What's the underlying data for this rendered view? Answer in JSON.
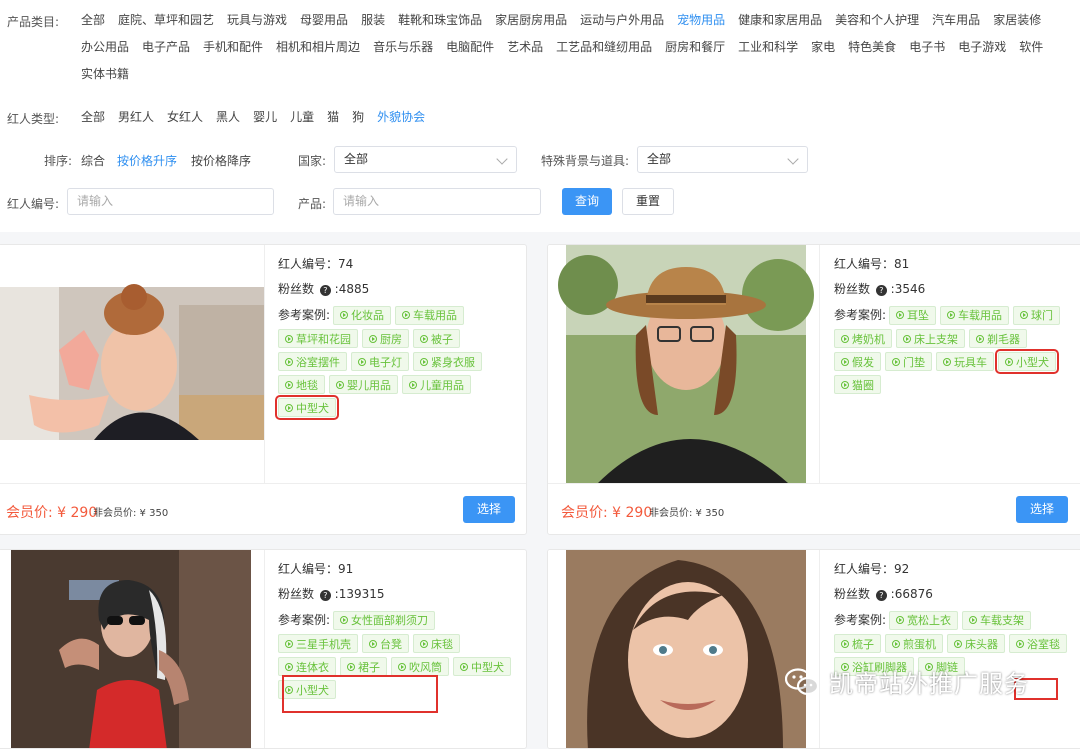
{
  "filters": {
    "category_label": "产品类目:",
    "categories": [
      "全部",
      "庭院、草坪和园艺",
      "玩具与游戏",
      "母婴用品",
      "服装",
      "鞋靴和珠宝饰品",
      "家居厨房用品",
      "运动与户外用品",
      "宠物用品",
      "健康和家居用品",
      "美容和个人护理",
      "汽车用品",
      "家居装修",
      "办公用品",
      "电子产品",
      "手机和配件",
      "相机和相片周边",
      "音乐与乐器",
      "电脑配件",
      "艺术品",
      "工艺品和缝纫用品",
      "厨房和餐厅",
      "工业和科学",
      "家电",
      "特色美食",
      "电子书",
      "电子游戏",
      "软件",
      "实体书籍"
    ],
    "active_category": "宠物用品",
    "influencer_label": "红人类型:",
    "influencer_types": [
      "全部",
      "男红人",
      "女红人",
      "黑人",
      "婴儿",
      "儿童",
      "猫",
      "狗",
      "外貌协会"
    ],
    "active_influencer": "外貌协会",
    "sort_label": "排序:",
    "sort_options": [
      "综合",
      "按价格升序",
      "按价格降序"
    ],
    "active_sort": "按价格升序",
    "country_label": "国家:",
    "country_value": "全部",
    "background_label": "特殊背景与道具:",
    "background_value": "全部",
    "id_label": "红人编号:",
    "id_placeholder": "请输入",
    "product_label": "产品:",
    "product_placeholder": "请输入",
    "query_button": "查询",
    "reset_button": "重置"
  },
  "cards": [
    {
      "id_text": "红人编号：74",
      "fans_label": "粉丝数",
      "fans_value": ":4885",
      "cases_label": "参考案例:",
      "tags": [
        "化妆品",
        "车载用品",
        "草坪和花园",
        "厨房",
        "被子",
        "浴室摆件",
        "电子灯",
        "紧身衣服",
        "地毯",
        "婴儿用品",
        "儿童用品",
        "中型犬"
      ],
      "member_price": "会员价: ¥ 290",
      "nonmember_price": "非会员价: ¥ 350",
      "choose": "选择"
    },
    {
      "id_text": "红人编号：81",
      "fans_label": "粉丝数",
      "fans_value": ":3546",
      "cases_label": "参考案例:",
      "tags": [
        "耳坠",
        "车载用品",
        "球门",
        "烤奶机",
        "床上支架",
        "剃毛器",
        "假发",
        "门垫",
        "玩具车",
        "小型犬",
        "猫圈"
      ],
      "member_price": "会员价: ¥ 290",
      "nonmember_price": "非会员价: ¥ 350",
      "choose": "选择"
    },
    {
      "id_text": "红人编号：91",
      "fans_label": "粉丝数",
      "fans_value": ":139315",
      "cases_label": "参考案例:",
      "tags": [
        "女性面部剃须刀",
        "三星手机壳",
        "台凳",
        "床毯",
        "连体衣",
        "裙子",
        "吹风筒",
        "中型犬",
        "小型犬"
      ]
    },
    {
      "id_text": "红人编号：92",
      "fans_label": "粉丝数",
      "fans_value": ":66876",
      "cases_label": "参考案例:",
      "tags": [
        "宽松上衣",
        "车载支架",
        "梳子",
        "煎蛋机",
        "床头器",
        "浴室毯",
        "浴缸刷脚器",
        "脚链"
      ]
    }
  ],
  "watermark": "凯帝站外推广服务",
  "icons": {
    "info": "question-icon",
    "tag": "play-circle-icon",
    "select": "chevron-down-icon",
    "wechat": "wechat-icon"
  },
  "colors": {
    "active": "#2f8ff0",
    "primary": "#3b95f5",
    "price": "#f35a3c",
    "tag_text": "#67c23a",
    "highlight": "#e0312c"
  }
}
